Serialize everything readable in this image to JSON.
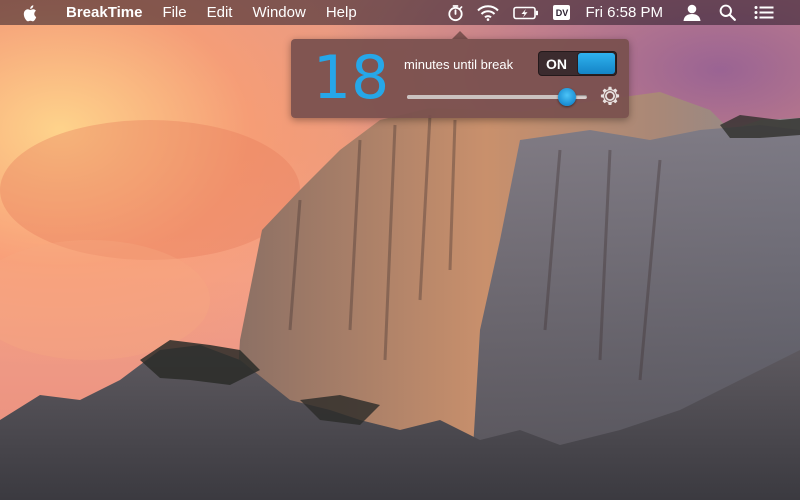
{
  "menubar": {
    "app_name": "BreakTime",
    "menus": [
      "File",
      "Edit",
      "Window",
      "Help"
    ],
    "status_items": {
      "timer_icon": "stopwatch-icon",
      "wifi_icon": "wifi-icon",
      "battery_icon": "battery-charging-icon",
      "dv_badge": "DV",
      "clock": "Fri 6:58 PM",
      "user_icon": "user-icon",
      "spotlight_icon": "search-icon",
      "notifications_icon": "list-icon"
    }
  },
  "popover": {
    "minutes_value": "18",
    "minutes_label": "minutes until break",
    "toggle_label": "ON",
    "toggle_state": "on",
    "slider_level": 0.89,
    "settings_icon": "gear-icon"
  },
  "colors": {
    "accent": "#26a7e8",
    "popover_bg": "#78504e"
  }
}
